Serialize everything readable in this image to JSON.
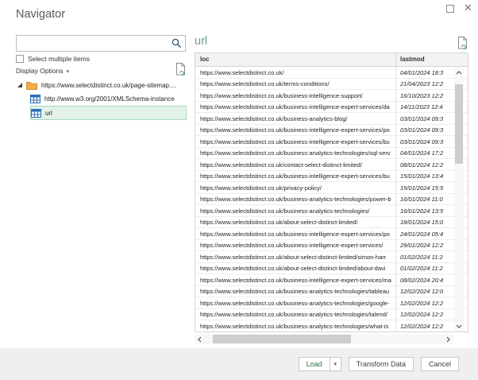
{
  "window": {
    "title": "Navigator",
    "controls": {
      "maximize": "maximize",
      "close": "✕"
    }
  },
  "sidebar": {
    "search": {
      "value": ""
    },
    "select_multiple_label": "Select multiple items",
    "display_options_label": "Display Options",
    "display_options_caret": "▾",
    "tree": [
      {
        "icon": "folder",
        "label": "https://www.selectdistinct.co.uk/page-sitemap....",
        "expanded": true,
        "selected": false
      },
      {
        "icon": "table",
        "label": "http://www.w3.org/2001/XMLSchema-instance",
        "selected": false
      },
      {
        "icon": "table",
        "label": "url",
        "selected": true
      }
    ]
  },
  "preview": {
    "title": "url",
    "columns": [
      "loc",
      "lastmod"
    ],
    "rows": [
      [
        "https://www.selectdistinct.co.uk/",
        "04/01/2024 18:3"
      ],
      [
        "https://www.selectdistinct.co.uk/terms-conditions/",
        "21/04/2023 12:2"
      ],
      [
        "https://www.selectdistinct.co.uk/business-intelligence-support/",
        "16/10/2023 12:2"
      ],
      [
        "https://www.selectdistinct.co.uk/business-intelligence-expert-services/da",
        "14/11/2023 12:4"
      ],
      [
        "https://www.selectdistinct.co.uk/business-analytics-blog/",
        "03/01/2024 09:3"
      ],
      [
        "https://www.selectdistinct.co.uk/business-intelligence-expert-services/po",
        "03/01/2024 09:3"
      ],
      [
        "https://www.selectdistinct.co.uk/business-intelligence-expert-services/bu",
        "03/01/2024 09:3"
      ],
      [
        "https://www.selectdistinct.co.uk/business-analytics-technologies/sql-serv",
        "04/01/2024 17:2"
      ],
      [
        "https://www.selectdistinct.co.uk/contact-select-distinct-limited/",
        "08/01/2024 12:2"
      ],
      [
        "https://www.selectdistinct.co.uk/business-intelligence-expert-services/bu",
        "15/01/2024 13:4"
      ],
      [
        "https://www.selectdistinct.co.uk/privacy-policy/",
        "15/01/2024 15:5"
      ],
      [
        "https://www.selectdistinct.co.uk/business-analytics-technologies/power-b",
        "16/01/2024 11:0"
      ],
      [
        "https://www.selectdistinct.co.uk/business-analytics-technologies/",
        "16/01/2024 13:5"
      ],
      [
        "https://www.selectdistinct.co.uk/about-select-distinct-limited/",
        "18/01/2024 15:0"
      ],
      [
        "https://www.selectdistinct.co.uk/business-intelligence-expert-services/po",
        "24/01/2024 05:4"
      ],
      [
        "https://www.selectdistinct.co.uk/business-intelligence-expert-services/",
        "29/01/2024 12:2"
      ],
      [
        "https://www.selectdistinct.co.uk/about-select-distinct-limited/simon-harr",
        "01/02/2024 11:2"
      ],
      [
        "https://www.selectdistinct.co.uk/about-select-distinct-limited/about-davi",
        "01/02/2024 11:2"
      ],
      [
        "https://www.selectdistinct.co.uk/business-intelligence-expert-services/ma",
        "08/02/2024 20:4"
      ],
      [
        "https://www.selectdistinct.co.uk/business-analytics-technologies/tableau",
        "12/02/2024 12:0"
      ],
      [
        "https://www.selectdistinct.co.uk/business-analytics-technologies/google-",
        "12/02/2024 12:2"
      ],
      [
        "https://www.selectdistinct.co.uk/business-analytics-technologies/talend/",
        "12/02/2024 12:2"
      ],
      [
        "https://www.selectdistinct.co.uk/business-analytics-technologies/what-is",
        "12/02/2024 12:2"
      ]
    ]
  },
  "footer": {
    "load_label": "Load",
    "load_caret": "▾",
    "transform_label": "Transform Data",
    "cancel_label": "Cancel"
  },
  "colors": {
    "selection_bg": "#e2f2e8",
    "selection_border": "#a9d7bc",
    "preview_title_green": "#6f9e88",
    "load_green": "#217346",
    "folder_orange": "#f0ad4a",
    "table_icon_blue": "#2d6fb5",
    "footer_bg": "#efefef"
  }
}
